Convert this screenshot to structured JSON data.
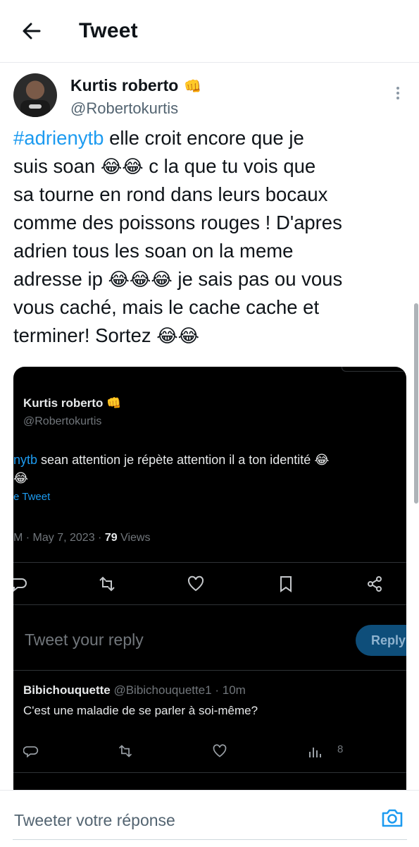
{
  "header": {
    "title": "Tweet"
  },
  "author": {
    "name": "Kurtis roberto",
    "badge_emoji": "👊",
    "handle": "@Robertokurtis"
  },
  "tweet": {
    "hashtag": "#adrienytb",
    "line1": " elle croit encore que je",
    "line2a": "suis soan ",
    "emoji_laugh": "😂",
    "line2b": " c la que tu vois que",
    "line3": "sa tourne en rond dans leurs bocaux",
    "line4": "comme des poissons rouges ! D'apres",
    "line5": "adrien tous les soan on la meme",
    "line6a": "adresse ip ",
    "line6b": " je sais pas ou vous",
    "line7": "vous caché, mais le cache cache et",
    "line8a": "terminer! Sortez "
  },
  "embedded": {
    "name": "Kurtis roberto",
    "handle": "@Robertokurtis",
    "tag_fragment": "nytb",
    "text": " sean attention je répète attention il a ton identité ",
    "translate": "e Tweet",
    "meta_time": "M · May 7, 2023 · ",
    "views_count": "79",
    "views_label": " Views",
    "reply_placeholder": "Tweet your reply",
    "reply_button": "Reply",
    "comment": {
      "name": "Bibichouquette",
      "handle_time": " @Bibichouquette1 · 10m",
      "text": "C'est une maladie de se parler à soi-même?",
      "views": "8"
    }
  },
  "bottom_bar": {
    "placeholder": "Tweeter votre réponse"
  },
  "colors": {
    "link": "#1d9bf0",
    "secondary": "#536471",
    "dark_bg": "#000000"
  }
}
